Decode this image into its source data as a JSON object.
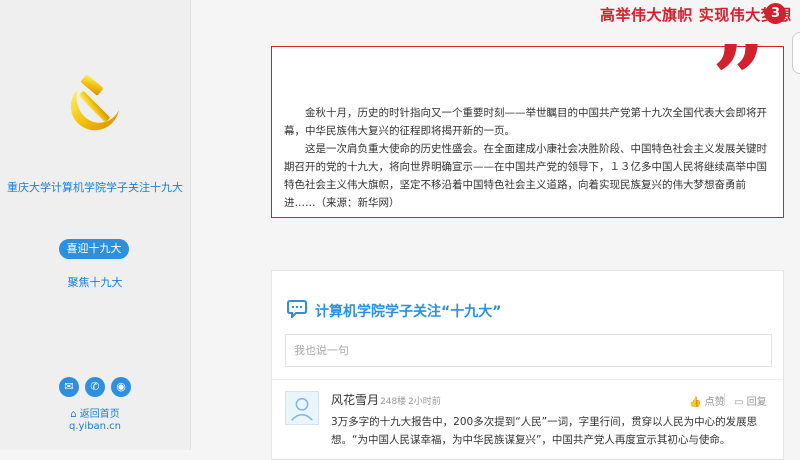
{
  "sidebar": {
    "org_name": "重庆大学计算机学院学子关注十九大",
    "nav_active": "喜迎十九大",
    "nav_item": "聚焦十九大",
    "social_icons": [
      "weibo-icon",
      "wechat-icon",
      "sina-icon"
    ],
    "back_home": "返回首页",
    "site_url": "q.yiban.cn"
  },
  "header": {
    "slogan": "高举伟大旗帜 实现伟大梦想",
    "badge": "3"
  },
  "quote": {
    "paragraph1": "金秋十月，历史的时针指向又一个重要时刻——举世瞩目的中国共产党第十九次全国代表大会即将开幕，中华民族伟大复兴的征程即将揭开新的一页。",
    "paragraph2": "这是一次肩负重大使命的历史性盛会。在全面建成小康社会决胜阶段、中国特色社会主义发展关键时期召开的党的十九大，将向世界明确宣示——在中国共产党的领导下，１３亿多中国人民将继续高举中国特色社会主义伟大旗帜，坚定不移沿着中国特色社会主义道路，向着实现民族复兴的伟大梦想奋勇前进……（来源：新华网）"
  },
  "comments": {
    "title": "计算机学院学子关注“十九大”",
    "input_placeholder": "我也说一句",
    "items": [
      {
        "user": "风花雪月",
        "floor": "248楼",
        "time": "2小时前",
        "like": "点赞",
        "reply": "回复",
        "body": "3万多字的十九大报告中，200多次提到“人民”一词，字里行间，贯穿以人民为中心的发展思想。“为中国人民谋幸福，为中华民族谋复兴”，中国共产党人再度宣示其初心与使命。"
      }
    ]
  },
  "colors": {
    "accent_blue": "#2c8fe0",
    "accent_red": "#d2202f"
  }
}
